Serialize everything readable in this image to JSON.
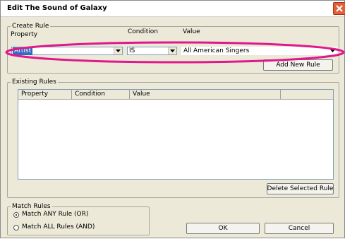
{
  "window": {
    "title": "Edit The Sound of Galaxy"
  },
  "create_rule": {
    "legend": "Create Rule",
    "property_label": "Property",
    "condition_label": "Condition",
    "value_label": "Value",
    "property_value": "Artist",
    "condition_value": "IS",
    "value_value": "All American Singers",
    "add_button": "Add New Rule"
  },
  "existing_rules": {
    "legend": "Existing Rules",
    "columns": [
      "Property",
      "Condition",
      "Value"
    ],
    "delete_button": "Delete Selected Rule"
  },
  "match_rules": {
    "legend": "Match Rules",
    "options": [
      {
        "label": "Match ANY Rule (OR)",
        "selected": true
      },
      {
        "label": "Match ALL Rules (AND)",
        "selected": false
      }
    ]
  },
  "buttons": {
    "ok": "OK",
    "cancel": "Cancel"
  },
  "colors": {
    "annotation_ellipse": "#e0188c",
    "selection": "#316ac5"
  }
}
